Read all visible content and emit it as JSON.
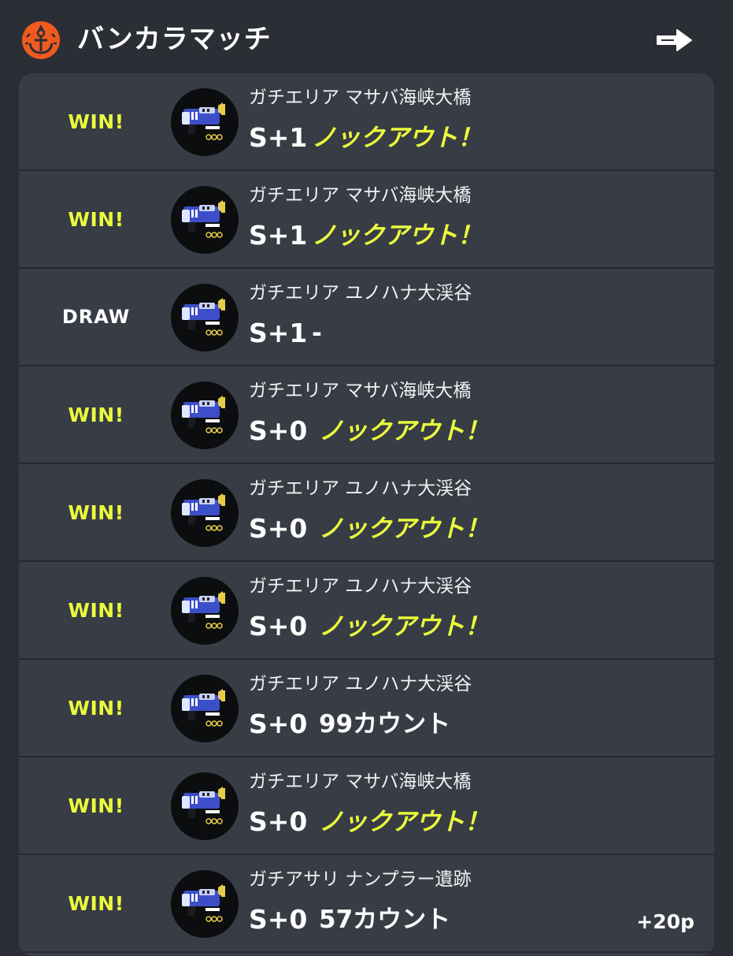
{
  "header": {
    "title": "バンカラマッチ"
  },
  "rows": [
    {
      "result": "WIN!",
      "result_type": "win",
      "stage": "ガチエリア マサバ海峡大橋",
      "rank": "S+1",
      "score": "ノックアウト！",
      "score_style": "knockout"
    },
    {
      "result": "WIN!",
      "result_type": "win",
      "stage": "ガチエリア マサバ海峡大橋",
      "rank": "S+1",
      "score": "ノックアウト！",
      "score_style": "knockout"
    },
    {
      "result": "DRAW",
      "result_type": "draw",
      "stage": "ガチエリア ユノハナ大渓谷",
      "rank": "S+1",
      "score": "-",
      "score_style": "plain"
    },
    {
      "result": "WIN!",
      "result_type": "win",
      "stage": "ガチエリア マサバ海峡大橋",
      "rank": "S+0",
      "score": "ノックアウト！",
      "score_style": "knockout"
    },
    {
      "result": "WIN!",
      "result_type": "win",
      "stage": "ガチエリア ユノハナ大渓谷",
      "rank": "S+0",
      "score": "ノックアウト！",
      "score_style": "knockout"
    },
    {
      "result": "WIN!",
      "result_type": "win",
      "stage": "ガチエリア ユノハナ大渓谷",
      "rank": "S+0",
      "score": "ノックアウト！",
      "score_style": "knockout"
    },
    {
      "result": "WIN!",
      "result_type": "win",
      "stage": "ガチエリア ユノハナ大渓谷",
      "rank": "S+0",
      "score": "99カウント",
      "score_style": "plain"
    },
    {
      "result": "WIN!",
      "result_type": "win",
      "stage": "ガチエリア マサバ海峡大橋",
      "rank": "S+0",
      "score": "ノックアウト！",
      "score_style": "knockout"
    },
    {
      "result": "WIN!",
      "result_type": "win",
      "stage": "ガチアサリ ナンプラー遺跡",
      "rank": "S+0",
      "score": "57カウント",
      "score_style": "plain",
      "points": "+20p"
    }
  ],
  "colors": {
    "win": "#eafc3c",
    "knockout": "#eafc3c",
    "panel": "#383c45",
    "background": "#2b2e35",
    "brand": "#f05a1e"
  },
  "icons": {
    "header": "anchor-emblem-icon",
    "arrow": "arrow-right-icon",
    "weapon": "blaster-weapon-icon"
  }
}
